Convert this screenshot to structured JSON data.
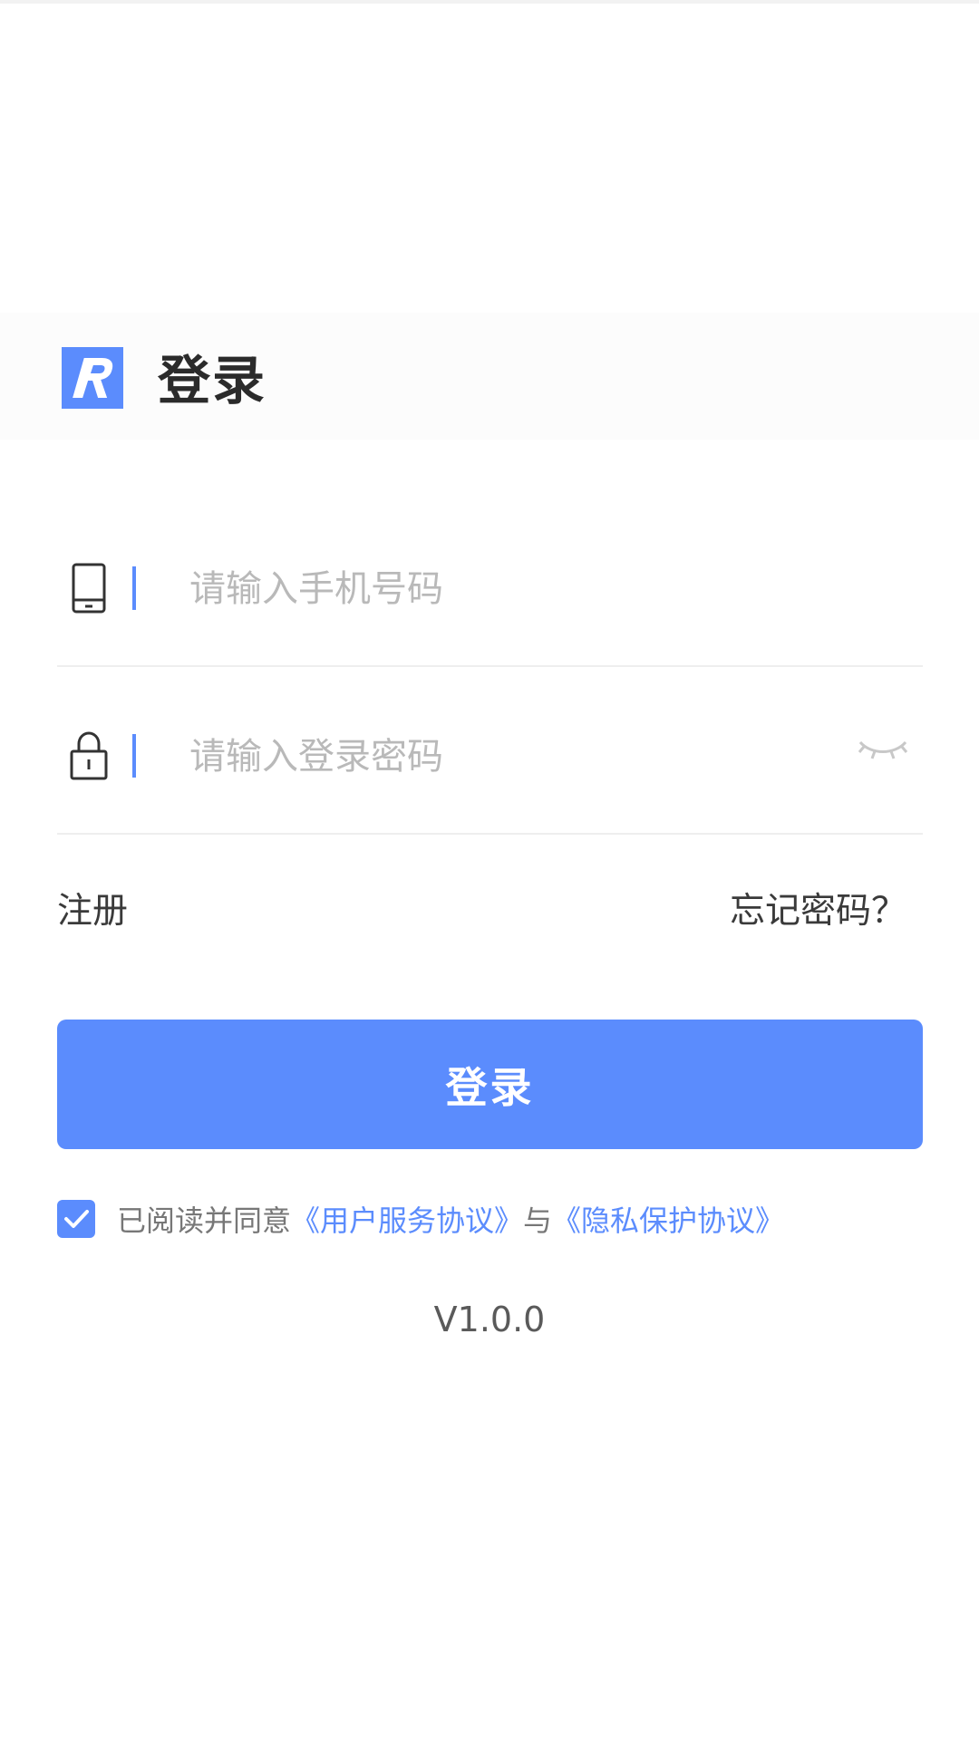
{
  "header": {
    "logo_icon": "app-logo-r",
    "title": "登录"
  },
  "form": {
    "phone": {
      "icon": "phone-icon",
      "placeholder": "请输入手机号码",
      "value": ""
    },
    "password": {
      "icon": "lock-icon",
      "placeholder": "请输入登录密码",
      "value": "",
      "toggle_icon": "eye-closed-icon"
    }
  },
  "links": {
    "register": "注册",
    "forgot_password": "忘记密码？"
  },
  "login_button": "登录",
  "agreement": {
    "checked": true,
    "prefix": "已阅读并同意",
    "user_agreement": "《用户服务协议》",
    "connector": "与",
    "privacy_agreement": "《隐私保护协议》"
  },
  "version": "V1.0.0",
  "colors": {
    "accent": "#5b8cfd",
    "text_dark": "#2b2b2b",
    "placeholder": "#b9b9b9",
    "divider": "#eeeeee"
  }
}
